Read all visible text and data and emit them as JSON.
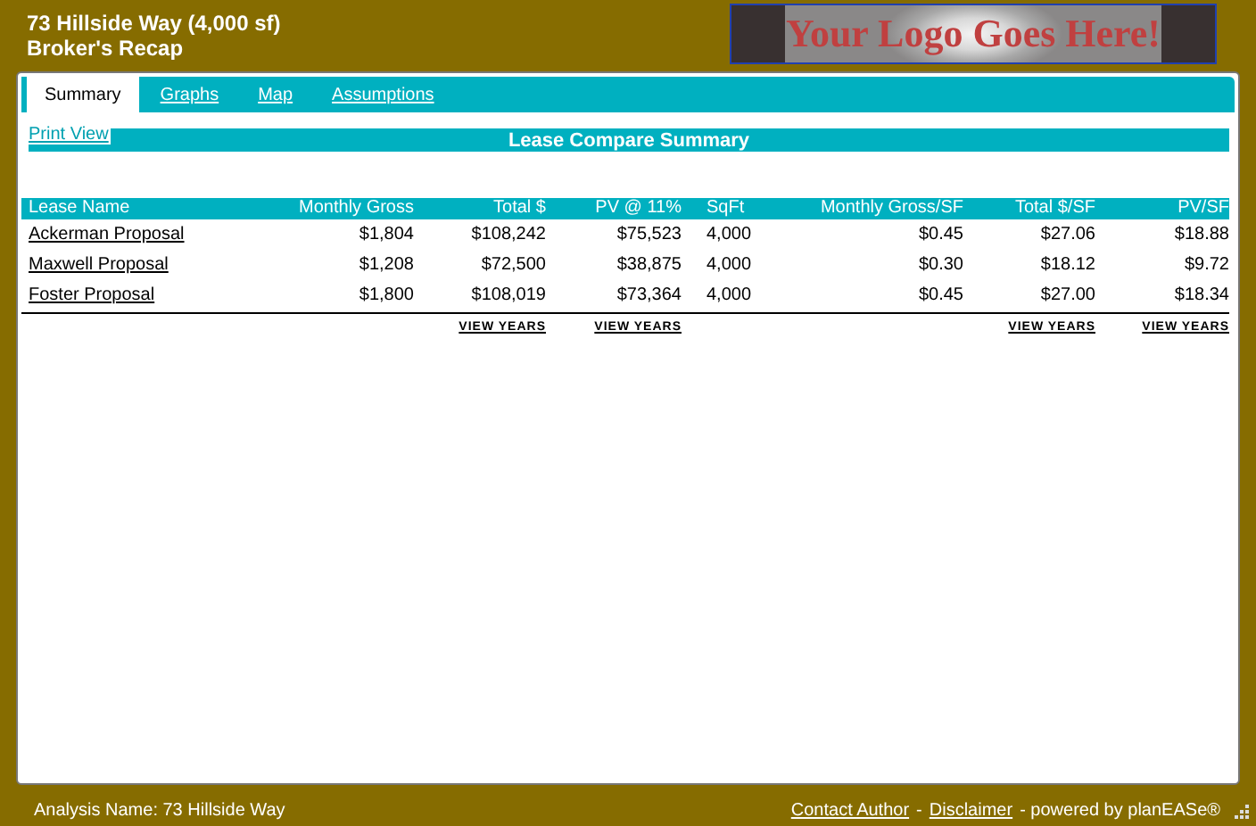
{
  "header": {
    "title": "73 Hillside Way (4,000 sf)",
    "subtitle": "Broker's Recap",
    "logo": "Your Logo Goes Here!"
  },
  "tabs": [
    {
      "label": "Summary",
      "selected": true
    },
    {
      "label": "Graphs",
      "selected": false
    },
    {
      "label": "Map",
      "selected": false
    },
    {
      "label": "Assumptions",
      "selected": false
    }
  ],
  "print_view": "Print View",
  "section_title": "Lease Compare Summary",
  "table": {
    "columns": [
      {
        "label": "Lease Name"
      },
      {
        "label": "Monthly Gross"
      },
      {
        "label": "Total $"
      },
      {
        "label": "PV @ 11%"
      },
      {
        "label": "SqFt"
      },
      {
        "label": "Monthly Gross/SF"
      },
      {
        "label": "Total $/SF"
      },
      {
        "label": "PV/SF"
      }
    ],
    "rows": [
      [
        "Ackerman Proposal",
        "$1,804",
        "$108,242",
        "$75,523",
        "4,000",
        "$0.45",
        "$27.06",
        "$18.88"
      ],
      [
        "Maxwell Proposal",
        "$1,208",
        "$72,500",
        "$38,875",
        "4,000",
        "$0.30",
        "$18.12",
        "$9.72"
      ],
      [
        "Foster Proposal",
        "$1,800",
        "$108,019",
        "$73,364",
        "4,000",
        "$0.45",
        "$27.00",
        "$18.34"
      ]
    ],
    "footer_links": [
      "VIEW YEARS",
      "VIEW YEARS",
      "VIEW YEARS",
      "VIEW YEARS"
    ]
  },
  "status_bar": {
    "analysis_name": "Analysis Name: 73 Hillside Way",
    "items": [
      {
        "kind": "link",
        "text": "Contact Author"
      },
      {
        "kind": "text",
        "text": "-"
      },
      {
        "kind": "link",
        "text": "Disclaimer"
      },
      {
        "kind": "text",
        "text": "- powered by planEASe®"
      }
    ]
  }
}
